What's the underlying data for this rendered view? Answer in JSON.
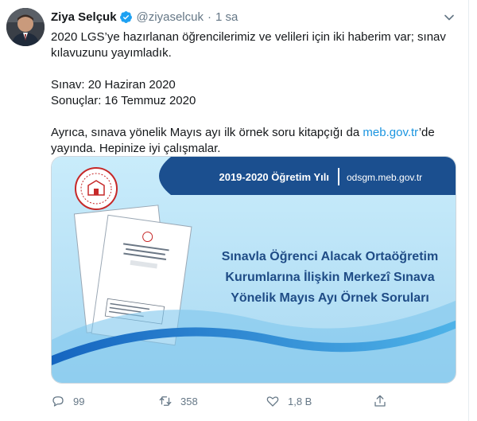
{
  "tweet": {
    "author_name": "Ziya Selçuk",
    "handle": "@ziyaselcuk",
    "separator": "·",
    "time": "1 sa",
    "verified": true,
    "paragraph1": "2020 LGS’ye hazırlanan öğrencilerimiz ve velileri için iki haberim var; sınav kılavuzunu yayımladık.",
    "exam_line": "Sınav: 20 Haziran 2020",
    "results_line": "Sonuçlar: 16 Temmuz 2020",
    "paragraph3_before_link": "Ayrıca, sınava yönelik Mayıs ayı ilk örnek soru kitapçığı da ",
    "link_text": "meb.gov.tr",
    "paragraph3_after_link": "’de yayında. Hepinize iyi çalışmalar."
  },
  "media": {
    "header_year": "2019-2020 Öğretim Yılı",
    "header_site": "odsgm.meb.gov.tr",
    "headline_line1": "Sınavla Öğrenci Alacak Ortaöğretim",
    "headline_line2": "Kurumlarına İlişkin Merkezî Sınava",
    "headline_line3": "Yönelik Mayıs Ayı Örnek Soruları"
  },
  "actions": {
    "reply_count": "99",
    "retweet_count": "358",
    "like_count": "1,8 B"
  },
  "colors": {
    "link": "#1b95e0",
    "verified": "#1da1f2",
    "media_bg": "#bfe3f7",
    "media_banner": "#1b4f8f",
    "headline": "#1f4c86"
  }
}
